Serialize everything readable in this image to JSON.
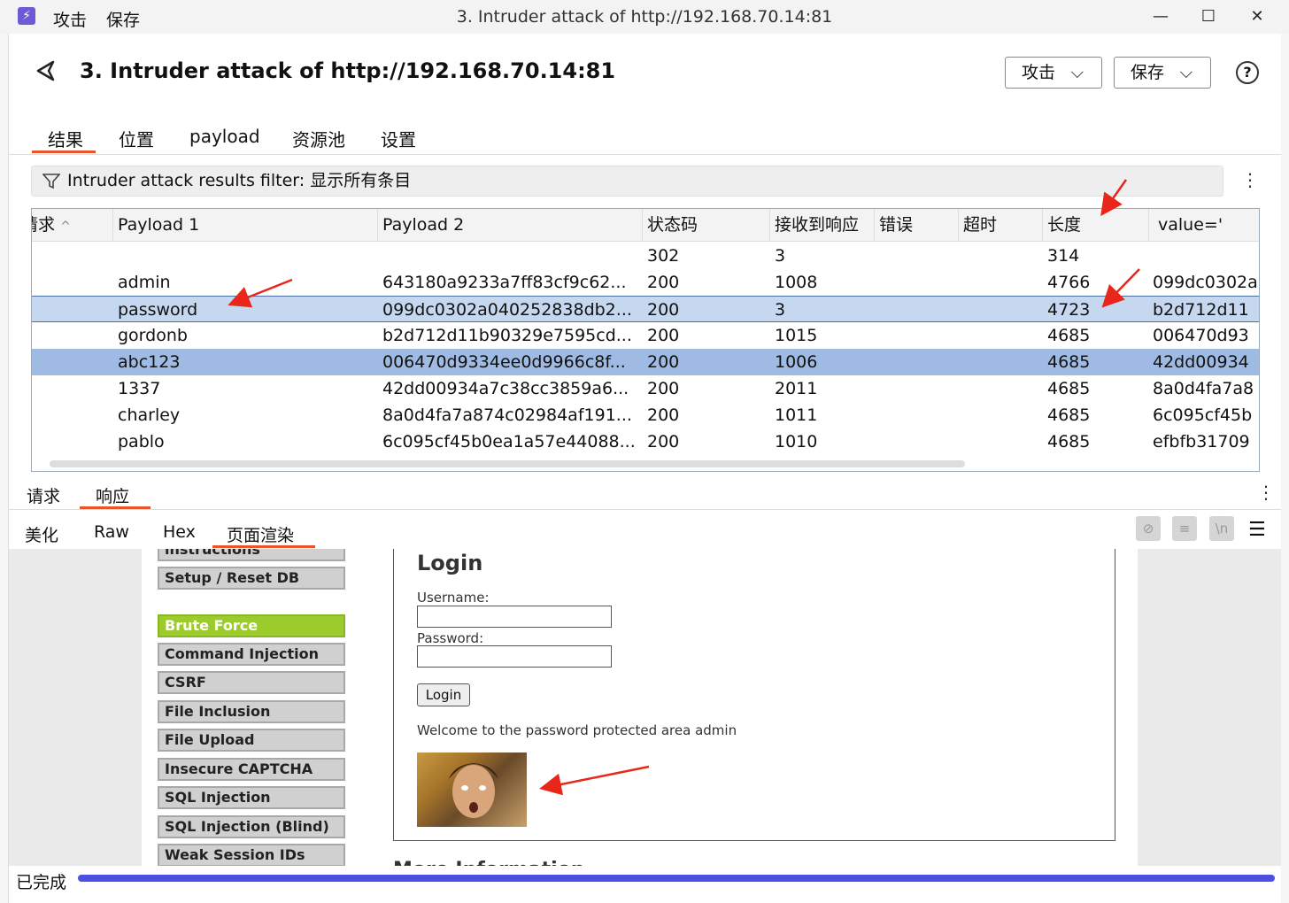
{
  "titlebar": {
    "menus": [
      "攻击",
      "保存"
    ],
    "title": "3. Intruder attack of http://192.168.70.14:81",
    "controls": {
      "minimize": "—",
      "maximize": "☐",
      "close": "✕"
    }
  },
  "header": {
    "title": "3. Intruder attack of http://192.168.70.14:81",
    "attack_label": "攻击",
    "save_label": "保存",
    "help": "?"
  },
  "tabs": [
    "结果",
    "位置",
    "payload",
    "资源池",
    "设置"
  ],
  "active_tab": "结果",
  "filter": {
    "text": "Intruder attack results filter: 显示所有条目"
  },
  "table": {
    "columns": [
      "请求",
      "Payload 1",
      "Payload 2",
      "状态码",
      "接收到响应",
      "错误",
      "超时",
      "长度",
      "value='"
    ],
    "rows": [
      {
        "p1": "",
        "p2": "",
        "status": "302",
        "recv": "3",
        "len": "314",
        "val": ""
      },
      {
        "p1": "admin",
        "p2": "643180a9233a7ff83cf9c62...",
        "status": "200",
        "recv": "1008",
        "len": "4766",
        "val": "099dc0302a"
      },
      {
        "p1": "password",
        "p2": "099dc0302a040252838db2...",
        "status": "200",
        "recv": "3",
        "len": "4723",
        "val": "b2d712d11"
      },
      {
        "p1": "gordonb",
        "p2": "b2d712d11b90329e7595cd...",
        "status": "200",
        "recv": "1015",
        "len": "4685",
        "val": "006470d93"
      },
      {
        "p1": "abc123",
        "p2": "006470d9334ee0d9966c8f...",
        "status": "200",
        "recv": "1006",
        "len": "4685",
        "val": "42dd00934"
      },
      {
        "p1": "1337",
        "p2": "42dd00934a7c38cc3859a6...",
        "status": "200",
        "recv": "2011",
        "len": "4685",
        "val": "8a0d4fa7a8"
      },
      {
        "p1": "charley",
        "p2": "8a0d4fa7a874c02984af191...",
        "status": "200",
        "recv": "1011",
        "len": "4685",
        "val": "6c095cf45b"
      },
      {
        "p1": "pablo",
        "p2": "6c095cf45b0ea1a57e44088...",
        "status": "200",
        "recv": "1010",
        "len": "4685",
        "val": "efbfb31709"
      }
    ]
  },
  "subtabs": [
    "请求",
    "响应"
  ],
  "render_tabs": [
    "美化",
    "Raw",
    "Hex",
    "页面渲染"
  ],
  "render_icons": [
    "eye-off-icon",
    "wrap-icon",
    "newline-icon",
    "menu-icon"
  ],
  "dvwa": {
    "menu": [
      "instructions",
      "Setup / Reset DB",
      "Brute Force",
      "Command Injection",
      "CSRF",
      "File Inclusion",
      "File Upload",
      "Insecure CAPTCHA",
      "SQL Injection",
      "SQL Injection (Blind)",
      "Weak Session IDs"
    ],
    "active": "Brute Force",
    "login_title": "Login",
    "username_label": "Username:",
    "password_label": "Password:",
    "login_button": "Login",
    "welcome": "Welcome to the password protected area admin",
    "more_info": "More Information"
  },
  "status": {
    "text": "已完成",
    "progress": 1.0
  }
}
